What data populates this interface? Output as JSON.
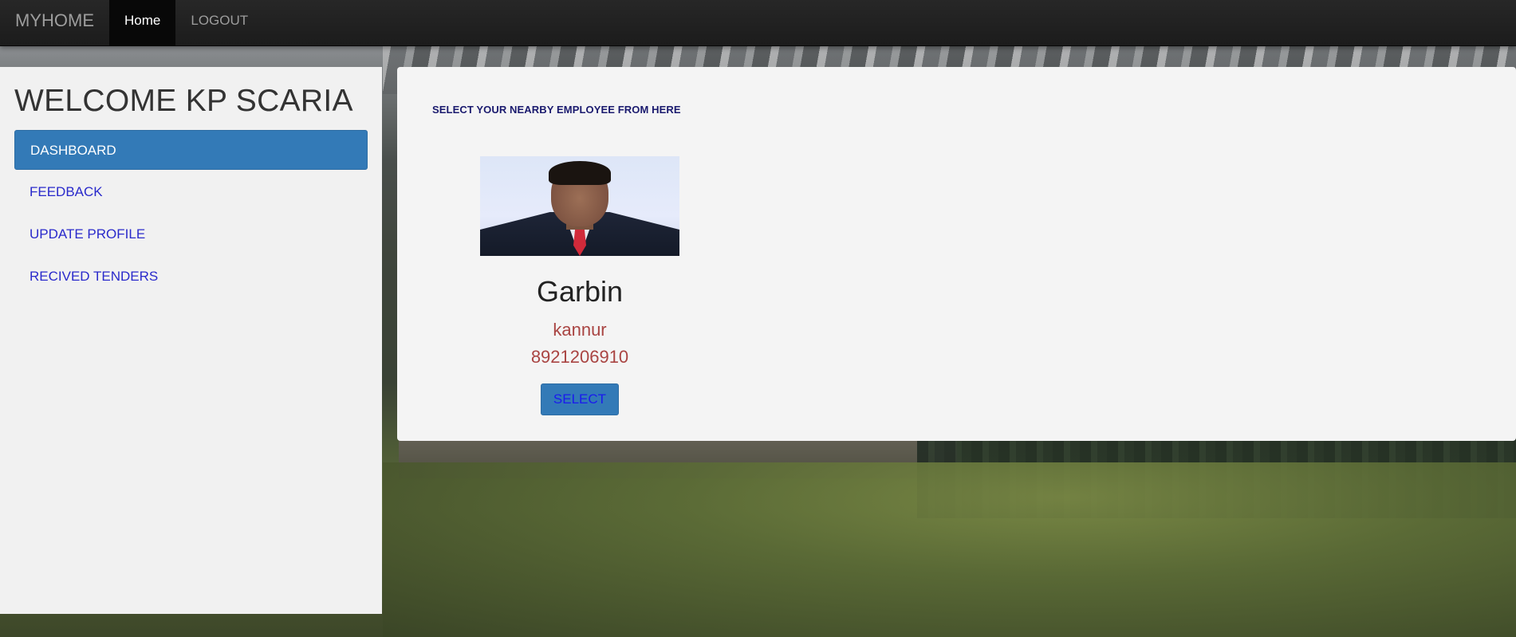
{
  "navbar": {
    "brand": "MYHOME",
    "items": [
      {
        "label": "Home",
        "active": true
      },
      {
        "label": "LOGOUT",
        "active": false
      }
    ]
  },
  "sidebar": {
    "welcome": "WELCOME KP SCARIA",
    "items": [
      {
        "label": "DASHBOARD",
        "active": true
      },
      {
        "label": "FEEDBACK",
        "active": false
      },
      {
        "label": "UPDATE PROFILE",
        "active": false
      },
      {
        "label": "RECIVED TENDERS",
        "active": false
      }
    ]
  },
  "main": {
    "heading": "SELECT YOUR NEARBY EMPLOYEE FROM HERE",
    "employee": {
      "name": "Garbin",
      "place": "kannur",
      "phone": "8921206910",
      "select_label": "SELECT"
    }
  },
  "colors": {
    "navbar_bg": "#222222",
    "active_menu": "#337ab7",
    "link": "#2a2acb",
    "detail_text": "#a94442"
  }
}
